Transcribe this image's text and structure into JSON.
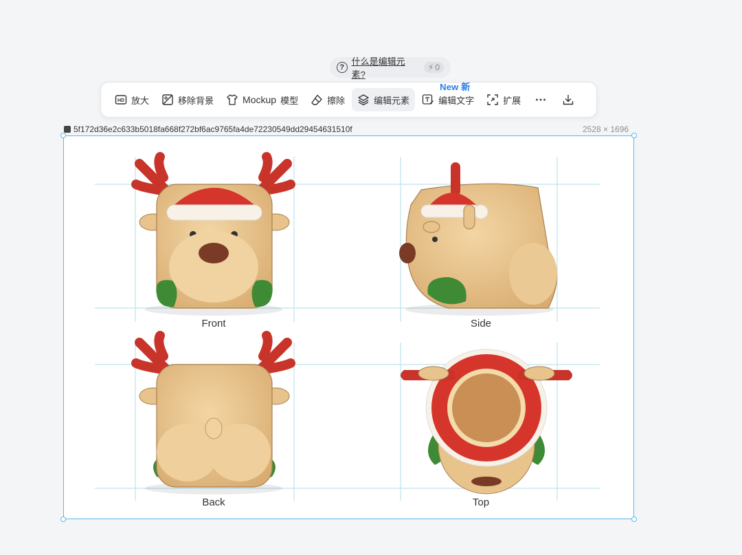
{
  "help": {
    "text": "什么是编辑元素?",
    "credits": "0",
    "question_icon": "question-circle-icon",
    "bolt_icon": "bolt-icon"
  },
  "toolbar": {
    "tools": [
      {
        "label": "放大",
        "icon": "hd-icon"
      },
      {
        "label": "移除背景",
        "icon": "remove-background-icon"
      },
      {
        "label_en": "Mockup",
        "label": "模型",
        "icon": "tshirt-icon"
      },
      {
        "label": "擦除",
        "icon": "eraser-icon"
      },
      {
        "label": "编辑元素",
        "icon": "layers-icon",
        "active": true
      },
      {
        "label": "编辑文字",
        "icon": "text-edit-icon",
        "badge": "New 新"
      },
      {
        "label": "扩展",
        "icon": "expand-icon"
      }
    ],
    "more_icon": "more-icon",
    "download_icon": "download-icon"
  },
  "file": {
    "name": "5f172d36e2c633b5018fa668f272bf6ac9765fa4de72230549dd29454631510f",
    "dimensions": "2528 × 1696"
  },
  "canvas": {
    "views": [
      {
        "caption": "Front"
      },
      {
        "caption": "Side"
      },
      {
        "caption": "Back"
      },
      {
        "caption": "Top"
      }
    ]
  },
  "colors": {
    "accent": "#2a7ee8",
    "selection": "#5ab7ee",
    "fur": "#e8c38c",
    "antler": "#c8342a",
    "hat": "#d6352c",
    "mitten": "#3f8a35",
    "nose": "#7a3b26"
  }
}
